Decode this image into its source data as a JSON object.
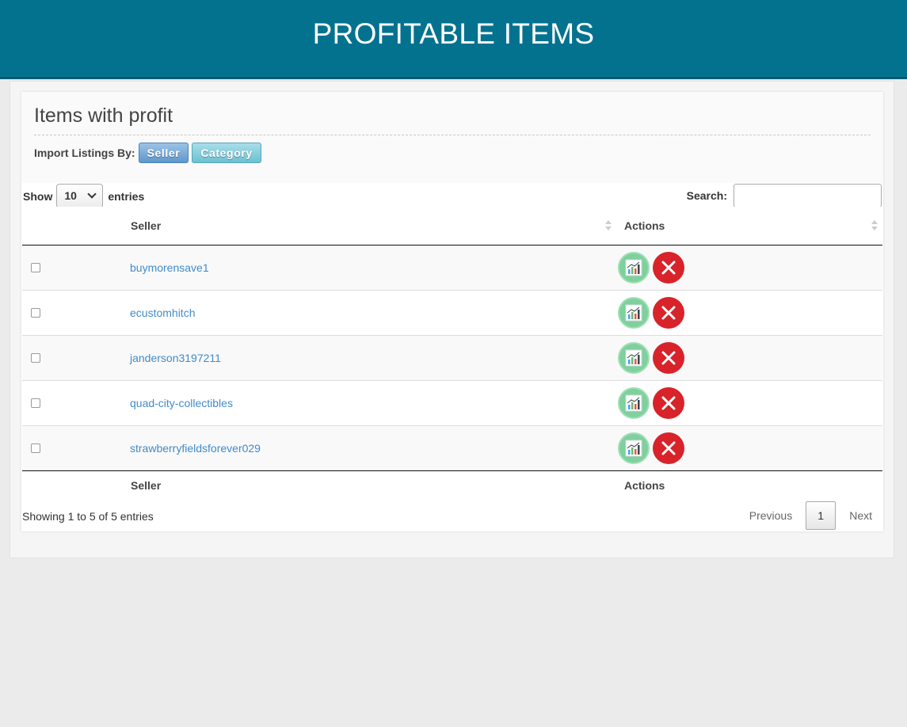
{
  "header": {
    "title": "PROFITABLE ITEMS"
  },
  "panel": {
    "title": "Items with profit",
    "import_label": "Import Listings By:",
    "buttons": {
      "seller": "Seller",
      "category": "Category"
    }
  },
  "table_controls": {
    "show_label": "Show",
    "page_length": "10",
    "entries_label": "entries",
    "search_label": "Search:",
    "search_value": ""
  },
  "table": {
    "columns": [
      "Seller",
      "Actions"
    ],
    "rows": [
      {
        "seller": "buymorensave1"
      },
      {
        "seller": "ecustomhitch"
      },
      {
        "seller": "janderson3197211"
      },
      {
        "seller": "quad-city-collectibles"
      },
      {
        "seller": "strawberryfieldsforever029"
      }
    ],
    "row_actions": [
      "chart-icon",
      "delete-icon"
    ]
  },
  "footer": {
    "info": "Showing 1 to 5 of 5 entries",
    "previous": "Previous",
    "current_page": "1",
    "next": "Next"
  },
  "colors": {
    "header_bg": "#03728f",
    "link": "#428bca",
    "chart_icon": "#7fd09c",
    "delete_icon": "#d8232a"
  }
}
